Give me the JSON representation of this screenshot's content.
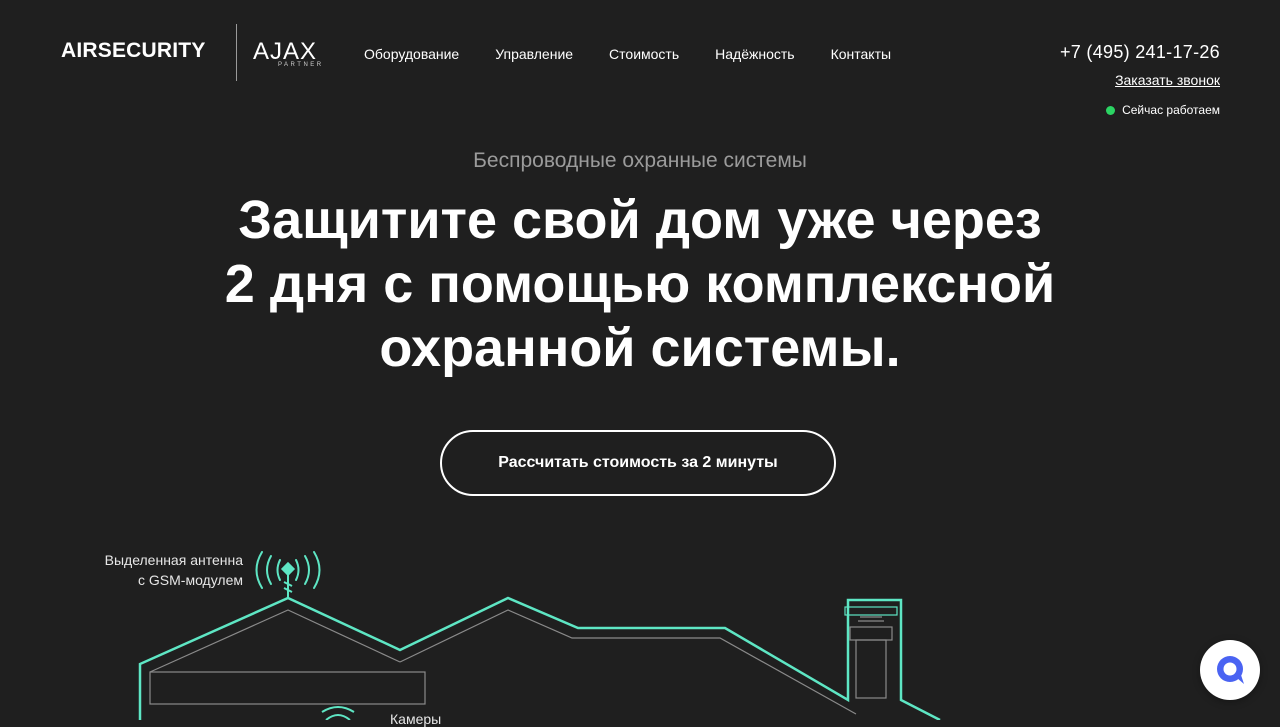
{
  "brand": {
    "name": "AIRSECURITY",
    "partner_logo": "AJAX",
    "partner_sub": "PARTNER"
  },
  "nav": {
    "items": [
      {
        "label": "Оборудование"
      },
      {
        "label": "Управление"
      },
      {
        "label": "Стоимость"
      },
      {
        "label": "Надёжность"
      },
      {
        "label": "Контакты"
      }
    ]
  },
  "contact": {
    "phone": "+7 (495) 241-17-26",
    "callback_label": "Заказать звонок",
    "status_text": "Сейчас работаем",
    "status_color": "#2bd463"
  },
  "hero": {
    "eyebrow": "Беспроводные охранные системы",
    "headline_lines": [
      "Защитите свой дом уже через",
      "2 дня с помощью комплексной",
      "охранной системы."
    ],
    "cta_label": "Рассчитать стоимость за 2 минуты"
  },
  "illustration": {
    "antenna_label_lines": [
      "Выделенная антенна",
      "с GSM-модулем"
    ],
    "camera_label": "Камеры",
    "accent_color": "#5ee6c4"
  },
  "chat_widget": {
    "icon": "chat-bubble-icon",
    "color": "#4a63f2"
  }
}
